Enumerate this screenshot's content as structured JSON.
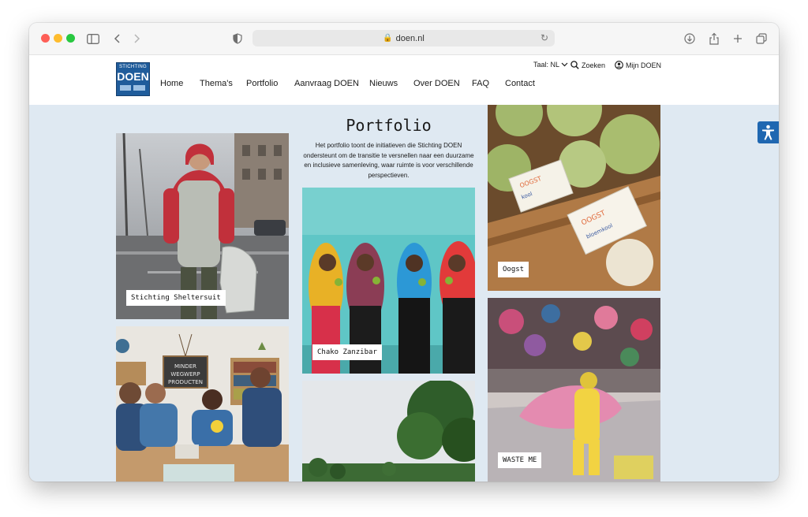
{
  "browser": {
    "url": "doen.nl"
  },
  "site": {
    "logo": {
      "line1": "STICHTING",
      "line2": "DOEN"
    },
    "nav": [
      "Home",
      "Thema's",
      "Portfolio",
      "Aanvraag DOEN",
      "Nieuws",
      "Over DOEN",
      "FAQ",
      "Contact"
    ],
    "utility": {
      "language": "Taal: NL",
      "search": "Zoeken",
      "account": "Mijn DOEN"
    }
  },
  "page": {
    "title": "Portfolio",
    "intro": "Het portfolio toont de initiatieven die Stichting DOEN ondersteunt om de transitie te versnellen naar een duurzame en inclusieve samenleving, waar ruimte is voor verschillende perspectieven."
  },
  "portfolio": [
    {
      "caption": "Stichting Sheltersuit"
    },
    {
      "caption": ""
    },
    {
      "caption": "Chako Zanzibar"
    },
    {
      "caption": ""
    },
    {
      "caption": "Oogst"
    },
    {
      "caption": "WASTE ME"
    }
  ],
  "colors": {
    "background": "#dfe9f2",
    "brand": "#1f5c9b",
    "accessibility": "#1f67b1"
  }
}
